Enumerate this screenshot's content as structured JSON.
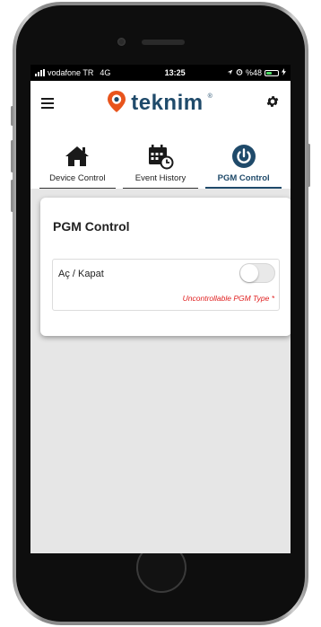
{
  "status_bar": {
    "carrier": "vodafone TR",
    "network": "4G",
    "time": "13:25",
    "battery_text": "%48"
  },
  "header": {
    "brand": "teknim",
    "brand_mark": "®",
    "menu_icon": "hamburger-menu-icon",
    "settings_icon": "gear-icon"
  },
  "tabs": [
    {
      "label": "Device Control",
      "icon": "home-icon",
      "active": false
    },
    {
      "label": "Event History",
      "icon": "calendar-clock-icon",
      "active": false
    },
    {
      "label": "PGM Control",
      "icon": "power-icon",
      "active": true
    }
  ],
  "pgm_card": {
    "title": "PGM Control",
    "row_label": "Aç / Kapat",
    "toggle_on": false,
    "note": "Uncontrollable PGM Type *"
  },
  "colors": {
    "brand": "#1f4a6a",
    "error_text": "#e02020",
    "screen_bg": "#e6e6e6"
  }
}
